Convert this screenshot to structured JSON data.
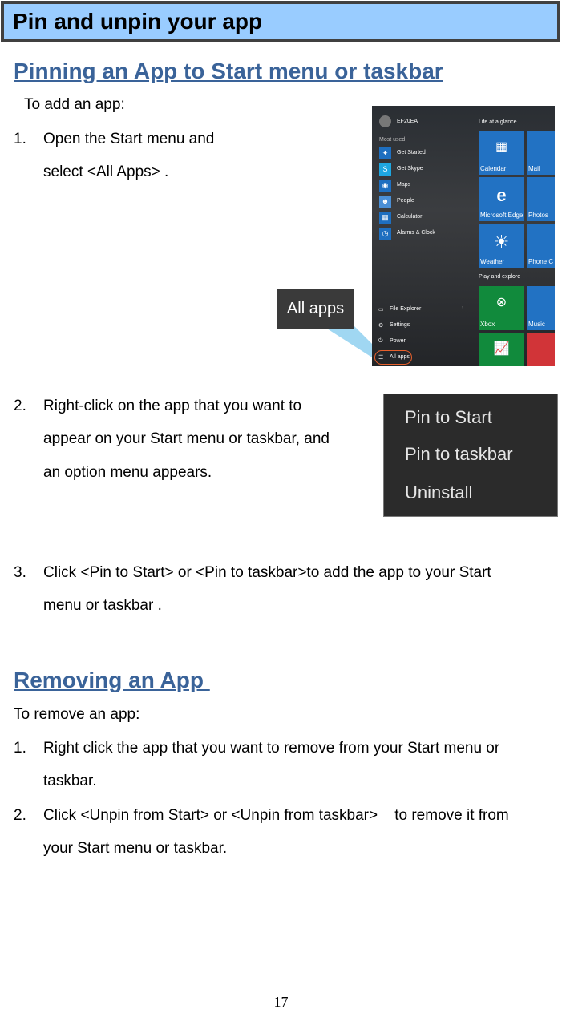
{
  "header": {
    "title": "Pin and unpin your app"
  },
  "pinning": {
    "heading": "Pinning an App to Start menu or taskbar",
    "intro": "To add an app:",
    "steps": [
      {
        "num": "1.",
        "lines": [
          "Open the Start menu and",
          "select <All Apps> ."
        ]
      },
      {
        "num": "2.",
        "lines": [
          "Right-click on the app that you want to",
          "appear on your Start menu or taskbar, and",
          "an option menu appears."
        ]
      },
      {
        "num": "3.",
        "lines": [
          "Click <Pin to Start> or <Pin to taskbar>to add the app to your Start",
          "menu or taskbar ."
        ]
      }
    ]
  },
  "start_menu_image": {
    "user": "EF20EA",
    "most_used_label": "Most used",
    "apps": [
      "Get Started",
      "Get Skype",
      "Maps",
      "People",
      "Calculator",
      "Alarms & Clock"
    ],
    "bottom": [
      "File Explorer",
      "Settings",
      "Power",
      "All apps"
    ],
    "group1": "Life at a glance",
    "group2": "Play and explore",
    "tiles": [
      "Calendar",
      "Mail",
      "Microsoft Edge",
      "Photos",
      "Weather",
      "Phone C",
      "Xbox",
      "Music"
    ],
    "callout": "All apps"
  },
  "context_menu_image": {
    "items": [
      "Pin to Start",
      "Pin to taskbar",
      "Uninstall"
    ]
  },
  "removing": {
    "heading": "Removing an App ",
    "intro": "To remove an app:",
    "steps": [
      {
        "num": "1.",
        "lines": [
          "Right click the app that you want to remove from your Start menu or",
          "taskbar."
        ]
      },
      {
        "num": "2.",
        "lines": [
          "Click <Unpin from Start> or <Unpin from taskbar>    to remove it from",
          "your Start menu or taskbar."
        ]
      }
    ]
  },
  "page_number": "17",
  "colors": {
    "header_bg": "#99ccff",
    "heading": "#3a6399",
    "tile_blue": "#2272c3",
    "tile_green": "#118a3c"
  }
}
